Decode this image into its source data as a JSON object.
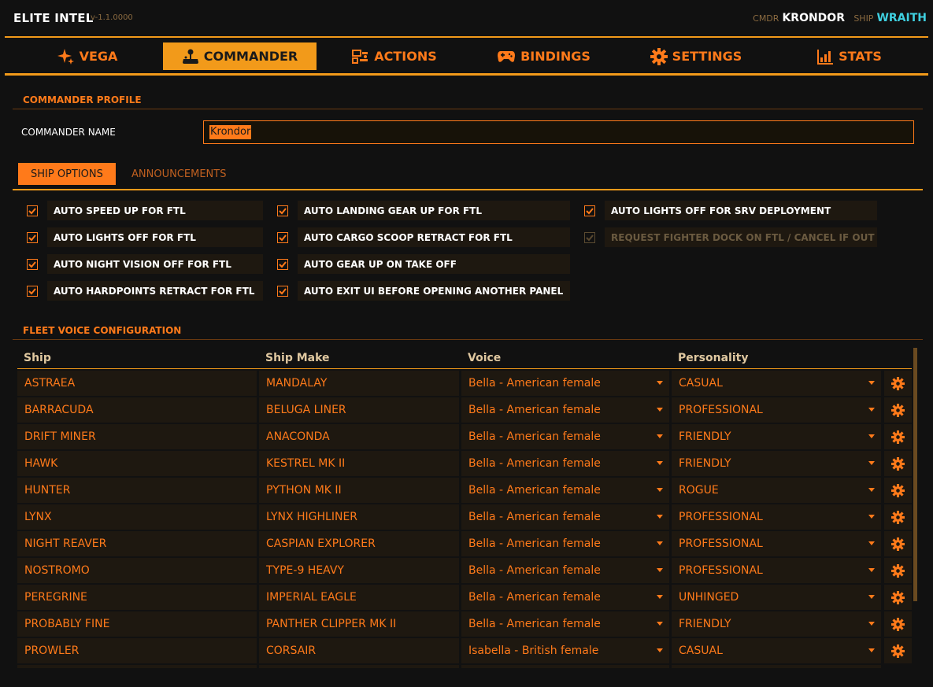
{
  "app": {
    "name": "ELITE INTEL",
    "version": "v-1.1.0000"
  },
  "status": {
    "cmdr_label": "CMDR",
    "cmdr_name": "KRONDOR",
    "ship_label": "SHIP",
    "ship_name": "WRAITH"
  },
  "nav": {
    "tabs": [
      {
        "label": "VEGA",
        "icon": "sparkle-icon"
      },
      {
        "label": "COMMANDER",
        "icon": "joystick-icon",
        "active": true
      },
      {
        "label": "ACTIONS",
        "icon": "actions-icon"
      },
      {
        "label": "BINDINGS",
        "icon": "gamepad-icon"
      },
      {
        "label": "SETTINGS",
        "icon": "gear-icon"
      },
      {
        "label": "STATS",
        "icon": "bar-chart-icon"
      }
    ]
  },
  "profile": {
    "section_title": "COMMANDER PROFILE",
    "name_label": "COMMANDER NAME",
    "name_value": "Krondor"
  },
  "subtabs": {
    "ship_options": "SHIP OPTIONS",
    "announcements": "ANNOUNCEMENTS"
  },
  "ship_options": [
    {
      "label": "AUTO SPEED UP FOR FTL",
      "checked": true
    },
    {
      "label": "AUTO LIGHTS OFF FOR FTL",
      "checked": true
    },
    {
      "label": "AUTO NIGHT VISION OFF FOR FTL",
      "checked": true
    },
    {
      "label": "AUTO HARDPOINTS RETRACT FOR FTL",
      "checked": true
    },
    {
      "label": "AUTO LANDING GEAR UP FOR FTL",
      "checked": true
    },
    {
      "label": "AUTO CARGO SCOOP RETRACT FOR FTL",
      "checked": true
    },
    {
      "label": "AUTO GEAR UP ON TAKE OFF",
      "checked": true
    },
    {
      "label": "AUTO EXIT UI BEFORE OPENING ANOTHER PANEL",
      "checked": true
    },
    {
      "label": "AUTO LIGHTS OFF FOR SRV DEPLOYMENT",
      "checked": true
    },
    {
      "label": "REQUEST FIGHTER DOCK ON FTL / CANCEL IF OUT",
      "checked": true,
      "disabled": true
    }
  ],
  "fleet": {
    "section_title": "FLEET VOICE CONFIGURATION",
    "columns": [
      "Ship",
      "Ship Make",
      "Voice",
      "Personality"
    ],
    "rows": [
      {
        "ship": "ASTRAEA",
        "make": "MANDALAY",
        "voice": "Bella - American female",
        "personality": "CASUAL"
      },
      {
        "ship": "BARRACUDA",
        "make": "BELUGA LINER",
        "voice": "Bella - American female",
        "personality": "PROFESSIONAL"
      },
      {
        "ship": "DRIFT MINER",
        "make": "ANACONDA",
        "voice": "Bella - American female",
        "personality": "FRIENDLY"
      },
      {
        "ship": "HAWK",
        "make": "KESTREL MK II",
        "voice": "Bella - American female",
        "personality": "FRIENDLY"
      },
      {
        "ship": "HUNTER",
        "make": "PYTHON MK II",
        "voice": "Bella - American female",
        "personality": "ROGUE"
      },
      {
        "ship": "LYNX",
        "make": "LYNX HIGHLINER",
        "voice": "Bella - American female",
        "personality": "PROFESSIONAL"
      },
      {
        "ship": "NIGHT REAVER",
        "make": "CASPIAN EXPLORER",
        "voice": "Bella - American female",
        "personality": "PROFESSIONAL"
      },
      {
        "ship": "NOSTROMO",
        "make": "TYPE-9 HEAVY",
        "voice": "Bella - American female",
        "personality": "PROFESSIONAL"
      },
      {
        "ship": "PEREGRINE",
        "make": "IMPERIAL EAGLE",
        "voice": "Bella - American female",
        "personality": "UNHINGED"
      },
      {
        "ship": "PROBABLY FINE",
        "make": "PANTHER CLIPPER MK II",
        "voice": "Bella - American female",
        "personality": "FRIENDLY"
      },
      {
        "ship": "PROWLER",
        "make": "CORSAIR",
        "voice": "Isabella - British female",
        "personality": "CASUAL"
      }
    ]
  },
  "colors": {
    "accent": "#ff7a1a",
    "gold": "#f29a1a",
    "background": "#111111",
    "cell": "#1e1810",
    "ship_name": "#3fd0e0"
  }
}
